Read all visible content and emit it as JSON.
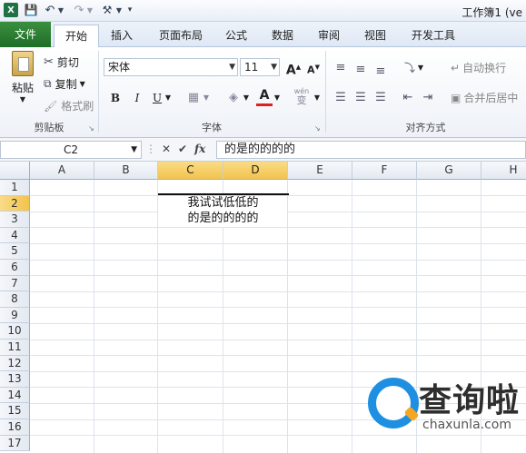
{
  "titlebar": {
    "app_icon": "X",
    "title": "工作簿1 (ve"
  },
  "tabs": [
    {
      "label": "文件"
    },
    {
      "label": "开始"
    },
    {
      "label": "插入"
    },
    {
      "label": "页面布局"
    },
    {
      "label": "公式"
    },
    {
      "label": "数据"
    },
    {
      "label": "审阅"
    },
    {
      "label": "视图"
    },
    {
      "label": "开发工具"
    }
  ],
  "ribbon": {
    "clipboard": {
      "paste": "粘贴",
      "cut": "剪切",
      "copy": "复制",
      "format_painter": "格式刷",
      "group_label": "剪贴板"
    },
    "font": {
      "font_name": "宋体",
      "font_size": "11",
      "bold": "B",
      "italic": "I",
      "underline": "U",
      "grow": "A",
      "shrink": "A",
      "font_color_glyph": "A",
      "wen": "wén",
      "wen_char": "变",
      "group_label": "字体"
    },
    "alignment": {
      "wrap_text": "自动换行",
      "merge_center": "合并后居中",
      "group_label": "对齐方式"
    }
  },
  "formula_bar": {
    "name_box": "C2",
    "fx": "fx",
    "content": "的是的的的的"
  },
  "sheet": {
    "columns": [
      "A",
      "B",
      "C",
      "D",
      "E",
      "F",
      "G",
      "H"
    ],
    "rows": [
      "1",
      "2",
      "3",
      "4",
      "5",
      "6",
      "7",
      "8",
      "9",
      "10",
      "11",
      "12",
      "13",
      "14",
      "15",
      "16",
      "17"
    ],
    "cell_c2_line1": "我试试低低的",
    "cell_c2_line2": "的是的的的的",
    "selection_color": "#f3c34c"
  },
  "watermark": {
    "title": "查询啦",
    "sub": "chaxunla.com"
  }
}
